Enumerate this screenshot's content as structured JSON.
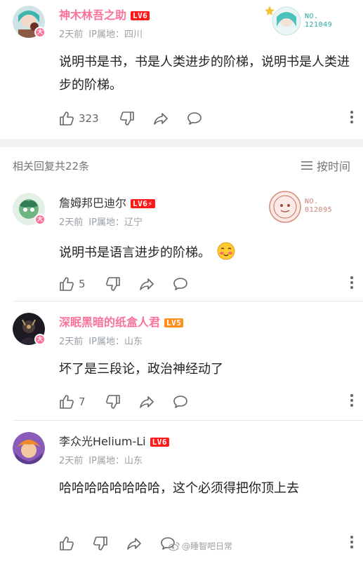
{
  "comments": [
    {
      "username": "神木林吾之助",
      "level": "LV6",
      "time": "2天前",
      "ip": "IP属地：四川",
      "content": "说明书是书，书是人类进步的阶梯，说明书是人类进步的阶梯。",
      "likes": "323",
      "fan_no_label": "NO.",
      "fan_no": "121049"
    },
    {
      "username": "詹姆邦巴迪尔",
      "level": "LV6⚡",
      "time": "2天前",
      "ip": "IP属地：辽宁",
      "content": "说明书是语言进步的阶梯。",
      "likes": "5",
      "fan_no_label": "NO.",
      "fan_no": "012095"
    },
    {
      "username": "深眠黑暗的纸盒人君",
      "level": "LV5",
      "time": "2天前",
      "ip": "IP属地：山东",
      "content": "坏了是三段论，政治神经动了",
      "likes": "7"
    },
    {
      "username": "李众光Helium-Li",
      "level": "LV6",
      "time": "2天前",
      "ip": "IP属地：山东",
      "content": "哈哈哈哈哈哈哈哈，这个必须得把你顶上去",
      "likes": ""
    }
  ],
  "replies_header": {
    "count_label": "相关回复共22条",
    "sort_label": "按时间"
  },
  "watermark": "@睡智吧日常",
  "colors": {
    "vip_name": "#fb7299",
    "lv6": "#ff1a1a",
    "lv5": "#ff8f1a",
    "meta": "#9aa0a6"
  }
}
